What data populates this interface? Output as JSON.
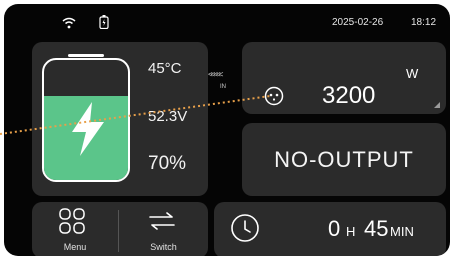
{
  "status_bar": {
    "wifi_icon": "wifi-icon",
    "battery_icon": "battery-status-icon",
    "date": "2025-02-26",
    "time": "18:12"
  },
  "battery": {
    "temperature": "45°C",
    "voltage": "52.3V",
    "percentage": "70%",
    "charge_level": 0.7,
    "fill_color": "#5bc58a",
    "icon": "lightning-bolt-icon"
  },
  "input": {
    "direction_arrows": "<<<<<",
    "direction_label": "IN",
    "power_value": "3200",
    "power_unit": "W",
    "icon": "ac-plug-icon"
  },
  "output": {
    "status_text": "NO-OUTPUT"
  },
  "nav": {
    "menu_label": "Menu",
    "menu_icon": "grid-menu-icon",
    "switch_label": "Switch",
    "switch_icon": "swap-arrows-icon"
  },
  "timer": {
    "icon": "clock-icon",
    "hours_value": "0",
    "hours_unit": "H",
    "minutes_value": "45",
    "minutes_unit": "MIN"
  },
  "colors": {
    "background": "#050505",
    "panel": "#2b2b2b",
    "accent_green": "#5bc58a",
    "annotation_orange": "#e8a04a"
  }
}
